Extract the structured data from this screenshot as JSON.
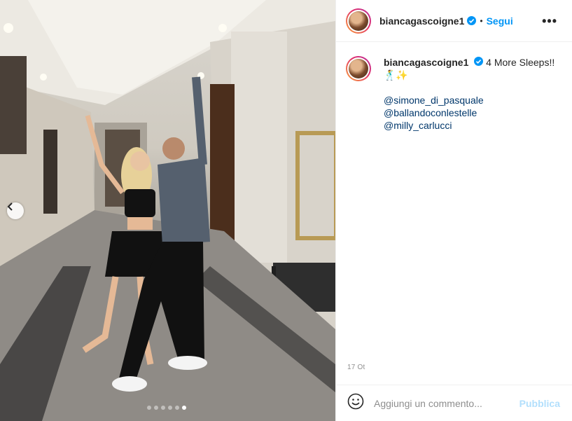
{
  "post": {
    "username": "biancagascoigne1",
    "follow_label": "Segui",
    "separator": "•",
    "more_label": "•••",
    "caption_text": "4 More Sleeps!!",
    "caption_emoji": "🕺✨",
    "mentions": [
      "@simone_di_pasquale",
      "@ballandoconlestelle",
      "@milly_carlucci"
    ],
    "date": "17 Ot",
    "comment_placeholder": "Aggiungi un commento...",
    "post_label": "Pubblica"
  },
  "carousel": {
    "total_slides": 6,
    "active_index": 5
  },
  "colors": {
    "accent": "#0095f6",
    "mention": "#00376b",
    "post_disabled": "#b2dffc"
  },
  "icons": [
    "verified-badge-icon",
    "more-options-icon",
    "chevron-left-icon",
    "emoji-icon"
  ]
}
